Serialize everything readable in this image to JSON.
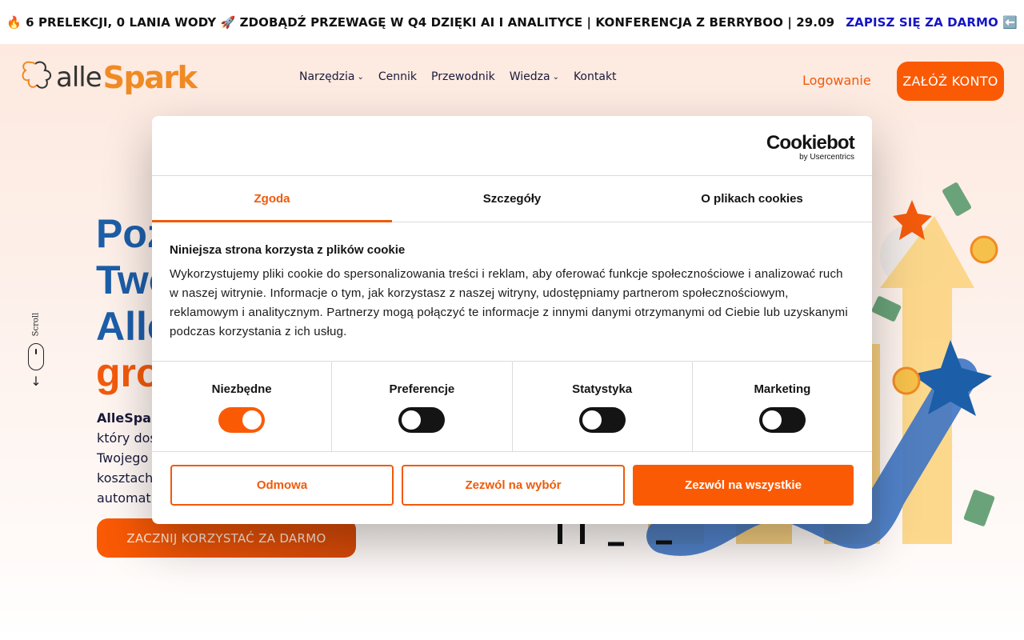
{
  "promo": {
    "text": "🔥 6 PRELEKCJI, 0 LANIA WODY 🚀 ZDOBĄDŹ PRZEWAGĘ W Q4 DZIĘKI AI I ANALITYCE | KONFERENCJA Z BERRYBOO | 29.09",
    "link": "ZAPISZ SIĘ ZA DARMO ⬅️"
  },
  "header": {
    "logo_alle": "alle",
    "logo_spark": "Spark",
    "nav": [
      {
        "label": "Narzędzia",
        "dropdown": true
      },
      {
        "label": "Cennik"
      },
      {
        "label": "Przewodnik"
      },
      {
        "label": "Wiedza",
        "dropdown": true
      },
      {
        "label": "Kontakt"
      }
    ],
    "chevron": "⌄",
    "login": "Logowanie",
    "signup": "ZAŁÓŻ KONTO"
  },
  "hero": {
    "headline": [
      "Poz",
      "Two",
      "Alle",
      "gro"
    ],
    "brand": "AlleSpar",
    "sub_lines": [
      "który dos",
      "Twojego",
      "kosztach",
      "automat"
    ],
    "cta": "ZACZNIJ KORZYSTAĆ ZA DARMO",
    "scroll_label": "Scroll",
    "scroll_arrow": "↓"
  },
  "cookie": {
    "brand_name": "Cookiebot",
    "brand_by": "by Usercentrics",
    "tabs": [
      "Zgoda",
      "Szczegóły",
      "O plikach cookies"
    ],
    "title": "Niniejsza strona korzysta z plików cookie",
    "body": "Wykorzystujemy pliki cookie do spersonalizowania treści i reklam, aby oferować funkcje społecznościowe i analizować ruch w naszej witrynie. Informacje o tym, jak korzystasz z naszej witryny, udostępniamy partnerom społecznościowym, reklamowym i analitycznym. Partnerzy mogą połączyć te informacje z innymi danymi otrzymanymi od Ciebie lub uzyskanymi podczas korzystania z ich usług.",
    "categories": [
      {
        "label": "Niezbędne",
        "on": true
      },
      {
        "label": "Preferencje",
        "on": false
      },
      {
        "label": "Statystyka",
        "on": false
      },
      {
        "label": "Marketing",
        "on": false
      }
    ],
    "buttons": {
      "deny": "Odmowa",
      "allow_selection": "Zezwól na wybór",
      "allow_all": "Zezwól na wszystkie"
    }
  },
  "colors": {
    "accent": "#fb5a05",
    "headline_blue": "#1c5ea8",
    "link_blue": "#1515c8"
  }
}
